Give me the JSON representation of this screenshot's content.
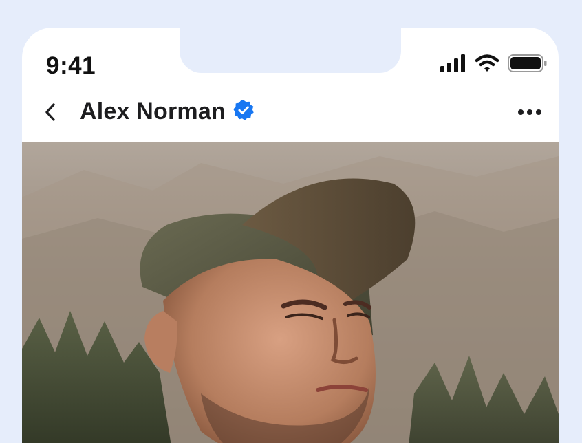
{
  "status_bar": {
    "time": "9:41",
    "icons": [
      "cellular-signal-icon",
      "wifi-icon",
      "battery-icon"
    ]
  },
  "header": {
    "back_icon": "chevron-left-icon",
    "profile_name": "Alex Norman",
    "verified_icon": "verified-badge-icon",
    "more_icon": "more-horizontal-icon"
  },
  "colors": {
    "background": "#e6edfb",
    "surface": "#ffffff",
    "text": "#1d1d1f",
    "verified_badge": "#1877f2"
  },
  "photo": {
    "subject": "profile-photo"
  }
}
